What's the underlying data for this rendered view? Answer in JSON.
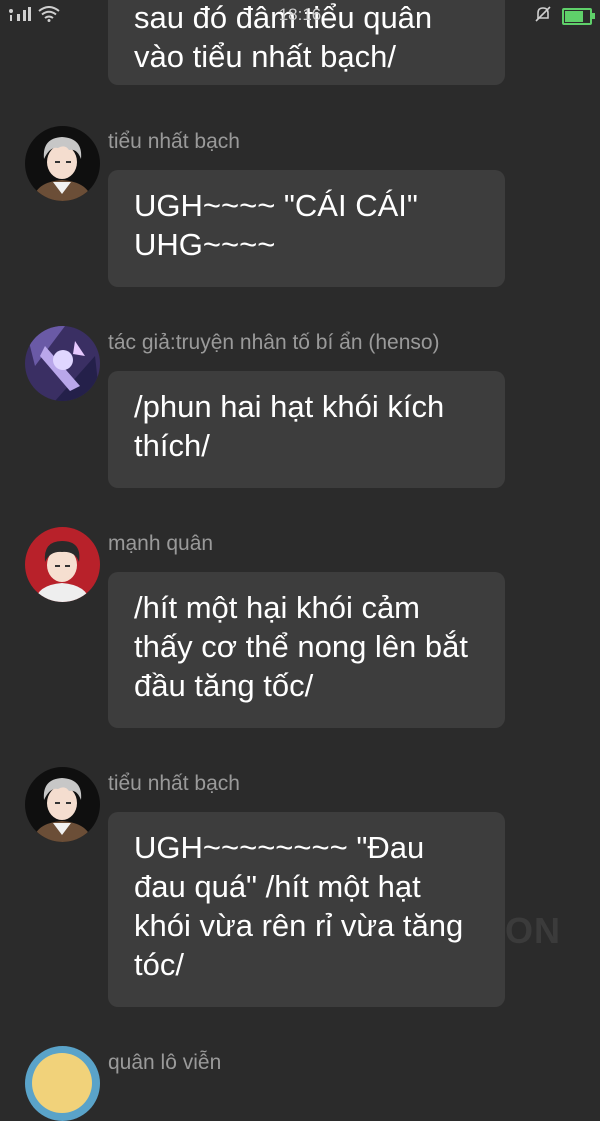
{
  "status_bar": {
    "time": "18:16",
    "signal_icon": "signal-icon",
    "wifi_icon": "wifi-icon",
    "mute_icon": "bell-muted-icon",
    "battery_icon": "battery-charging-icon",
    "battery_color": "#5fd06a"
  },
  "messages": [
    {
      "sender": "",
      "text": "sau đó đâm tiểu quân vào tiểu nhất bạch/"
    },
    {
      "sender": "tiểu nhất bạch",
      "text": "UGH~~~~ \"CÁI CÁI\" UHG~~~~"
    },
    {
      "sender": "tác giả:truyện nhân tố bí ẩn (henso)",
      "text": "/phun hai hạt khói kích thích/"
    },
    {
      "sender": "mạnh quân",
      "text": "/hít một hại khói cảm thấy cơ thể nong lên bắt đầu tăng tốc/"
    },
    {
      "sender": "tiểu nhất bạch",
      "text": "UGH~~~~~~~~ \"Đau đau quá\" /hít một hạt khói vừa rên rỉ vừa tăng tóc/"
    },
    {
      "sender": "quân lô viễn",
      "text": ""
    }
  ],
  "watermark": "ON",
  "colors": {
    "background": "#2b2b2b",
    "bubble": "#3d3d3d",
    "sender_name": "#9a9a9a"
  }
}
